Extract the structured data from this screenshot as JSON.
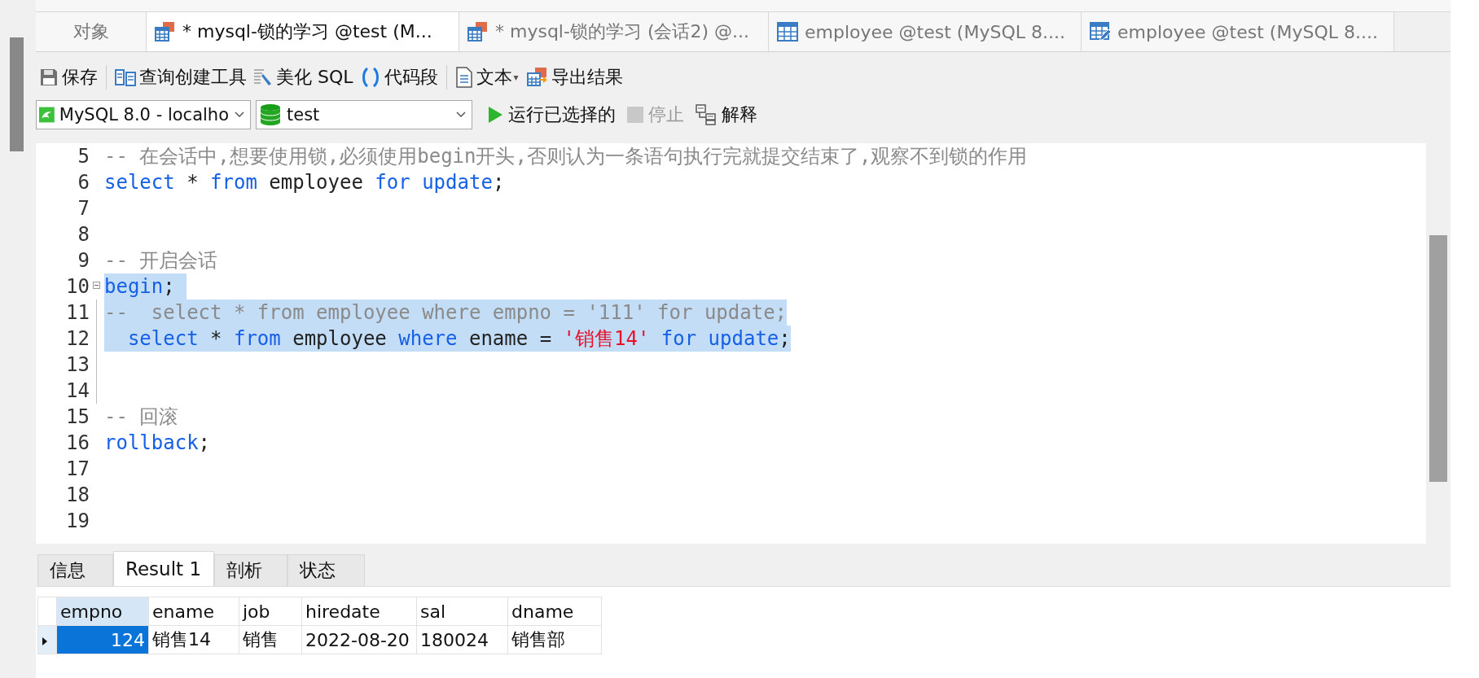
{
  "doc_tabs": [
    {
      "label": "对象",
      "kind": "plain",
      "selected": false
    },
    {
      "label": "* mysql-锁的学习 @test (M...",
      "kind": "query",
      "selected": true
    },
    {
      "label": "* mysql-锁的学习 (会话2) @...",
      "kind": "query",
      "selected": false
    },
    {
      "label": "employee @test (MySQL 8....",
      "kind": "table",
      "selected": false
    },
    {
      "label": "employee @test (MySQL 8....",
      "kind": "design",
      "selected": false
    }
  ],
  "toolbar": [
    {
      "label": "保存",
      "kind": "save"
    },
    {
      "label": "查询创建工具",
      "kind": "builder"
    },
    {
      "label": "美化 SQL",
      "kind": "beautify"
    },
    {
      "label": "代码段",
      "kind": "snippet"
    },
    {
      "label": "文本",
      "kind": "text",
      "caret": "▾"
    },
    {
      "label": "导出结果",
      "kind": "export"
    }
  ],
  "connection": {
    "value": "MySQL 8.0 - localho"
  },
  "database": {
    "value": "test"
  },
  "run_bar": [
    {
      "label": "运行已选择的",
      "kind": "run",
      "disabled": false
    },
    {
      "label": "停止",
      "kind": "stop",
      "disabled": true
    },
    {
      "label": "解释",
      "kind": "explain",
      "disabled": false
    }
  ],
  "editor": {
    "lines": [
      {
        "number": "5",
        "kind": "plain",
        "selected": false,
        "tokens": [
          {
            "text": "-- 在会话中,想要使用锁,必须使用begin开头,否则认为一条语句执行完就提交结束了,观察不到锁的作用",
            "kind": "comment"
          }
        ]
      },
      {
        "number": "6",
        "kind": "plain",
        "selected": false,
        "tokens": [
          {
            "text": "select",
            "kind": "keyword"
          },
          {
            "text": " * ",
            "kind": "plain"
          },
          {
            "text": "from",
            "kind": "keyword"
          },
          {
            "text": " employee ",
            "kind": "plain"
          },
          {
            "text": "for",
            "kind": "keyword"
          },
          {
            "text": " update",
            "kind": "keyword"
          },
          {
            "text": ";",
            "kind": "plain"
          }
        ]
      },
      {
        "number": "7",
        "kind": "plain",
        "selected": false
      },
      {
        "number": "8",
        "kind": "plain",
        "selected": false
      },
      {
        "number": "9",
        "kind": "plain",
        "selected": false,
        "tokens": [
          {
            "text": "-- 开启会话",
            "kind": "comment"
          }
        ]
      },
      {
        "number": "10",
        "kind": "fold-start",
        "selected": true,
        "tokens": [
          {
            "text": "begin",
            "kind": "keyword"
          },
          {
            "text": "; ",
            "kind": "plain"
          }
        ]
      },
      {
        "number": "11",
        "kind": "fold-body",
        "selected": true,
        "tokens": [
          {
            "text": "--  select * from employee where empno = '111' for update;",
            "kind": "comment"
          }
        ]
      },
      {
        "number": "12",
        "kind": "fold-body",
        "selected": true,
        "tokens": [
          {
            "text": "  select",
            "kind": "keyword"
          },
          {
            "text": " * ",
            "kind": "plain"
          },
          {
            "text": "from",
            "kind": "keyword"
          },
          {
            "text": " employee ",
            "kind": "plain"
          },
          {
            "text": "where",
            "kind": "keyword"
          },
          {
            "text": " ename = ",
            "kind": "plain"
          },
          {
            "text": "'销售14'",
            "kind": "string"
          },
          {
            "text": " for",
            "kind": "keyword"
          },
          {
            "text": " update",
            "kind": "keyword"
          },
          {
            "text": ";",
            "kind": "plain"
          }
        ]
      },
      {
        "number": "13",
        "kind": "fold-body",
        "selected": false
      },
      {
        "number": "14",
        "kind": "fold-body",
        "selected": false
      },
      {
        "number": "15",
        "kind": "plain",
        "selected": false,
        "tokens": [
          {
            "text": "-- 回滚",
            "kind": "comment"
          }
        ]
      },
      {
        "number": "16",
        "kind": "plain",
        "selected": false,
        "tokens": [
          {
            "text": "rollback",
            "kind": "keyword"
          },
          {
            "text": ";",
            "kind": "plain"
          }
        ]
      },
      {
        "number": "17",
        "kind": "plain",
        "selected": false
      },
      {
        "number": "18",
        "kind": "plain",
        "selected": false
      },
      {
        "number": "19",
        "kind": "plain",
        "selected": false
      }
    ]
  },
  "result_tabs": [
    {
      "label": "信息",
      "selected": false
    },
    {
      "label": "Result 1",
      "selected": true
    },
    {
      "label": "剖析",
      "selected": false
    },
    {
      "label": "状态",
      "selected": false
    }
  ],
  "grid": {
    "columns": [
      {
        "label": "empno",
        "selected": true
      },
      {
        "label": "ename",
        "selected": false
      },
      {
        "label": "job",
        "selected": false
      },
      {
        "label": "hiredate",
        "selected": false
      },
      {
        "label": "sal",
        "selected": false
      },
      {
        "label": "dname",
        "selected": false
      }
    ],
    "rows": [
      {
        "current": true,
        "cells": [
          {
            "text": "124",
            "kind": "number",
            "selected": true
          },
          {
            "text": "销售14",
            "kind": "text",
            "selected": false
          },
          {
            "text": "销售",
            "kind": "text",
            "selected": false
          },
          {
            "text": "2022-08-20",
            "kind": "text",
            "selected": false
          },
          {
            "text": "180024",
            "kind": "text",
            "selected": false
          },
          {
            "text": "销售部",
            "kind": "text",
            "selected": false
          }
        ]
      }
    ]
  }
}
